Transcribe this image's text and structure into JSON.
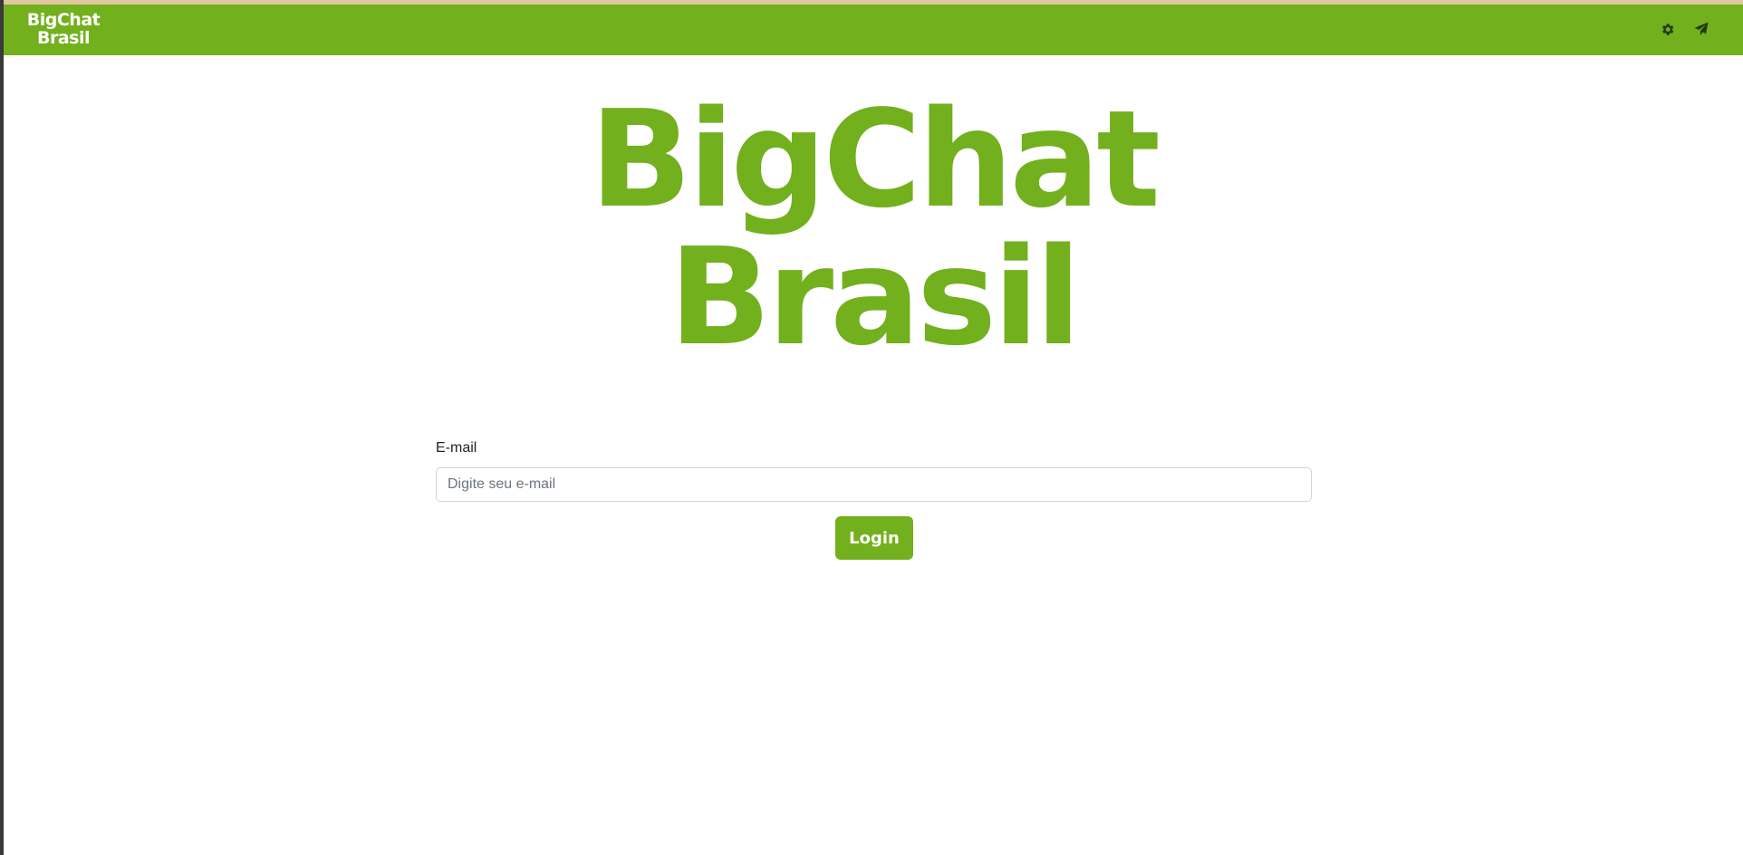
{
  "navbar": {
    "brand_line1": "BigChat",
    "brand_line2": "Brasil",
    "icons": [
      "gear-icon",
      "paper-plane-icon"
    ]
  },
  "hero": {
    "line1": "BigChat",
    "line2": "Brasil"
  },
  "login_form": {
    "email_label": "E-mail",
    "email_value": "",
    "email_placeholder": "Digite seu e-mail",
    "login_label": "Login"
  },
  "colors": {
    "brand_green": "#72b01d",
    "top_stripe": "#e0c9a0",
    "icon_dark": "#1f3a10"
  }
}
